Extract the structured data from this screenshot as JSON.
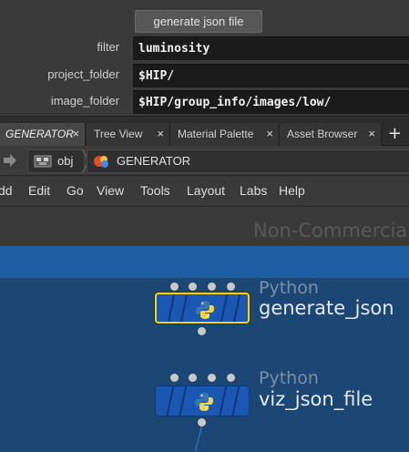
{
  "params": {
    "button_label": "generate json file",
    "rows": [
      {
        "label": "filter",
        "value": "luminosity"
      },
      {
        "label": "project_folder",
        "value": "$HIP/"
      },
      {
        "label": "image_folder",
        "value": "$HIP/group_info/images/low/"
      }
    ]
  },
  "tabs": [
    {
      "label": "GENERATOR",
      "close": "×",
      "active": true
    },
    {
      "label": "Tree View",
      "close": "×",
      "active": false
    },
    {
      "label": "Material Palette",
      "close": "×",
      "active": false
    },
    {
      "label": "Asset Browser",
      "close": "×",
      "active": false
    }
  ],
  "tab_add": "+",
  "path": {
    "items": [
      {
        "label": "obj",
        "icon": "obj-network-icon"
      },
      {
        "label": "GENERATOR",
        "icon": "geometry-node-icon"
      }
    ]
  },
  "menu": [
    "dd",
    "Edit",
    "Go",
    "View",
    "Tools",
    "Layout",
    "Labs",
    "Help"
  ],
  "network": {
    "watermark": "Non-Commercial",
    "nodes": [
      {
        "type": "Python",
        "name": "generate_json",
        "selected": true,
        "icon": "python-icon"
      },
      {
        "type": "Python",
        "name": "viz_json_file",
        "selected": false,
        "icon": "python-icon"
      }
    ]
  },
  "colors": {
    "node_fill": "#1a58b4",
    "selected_outline": "#f2d21b",
    "network_bg": "#1c4674",
    "network_band": "#1d5ea5"
  }
}
